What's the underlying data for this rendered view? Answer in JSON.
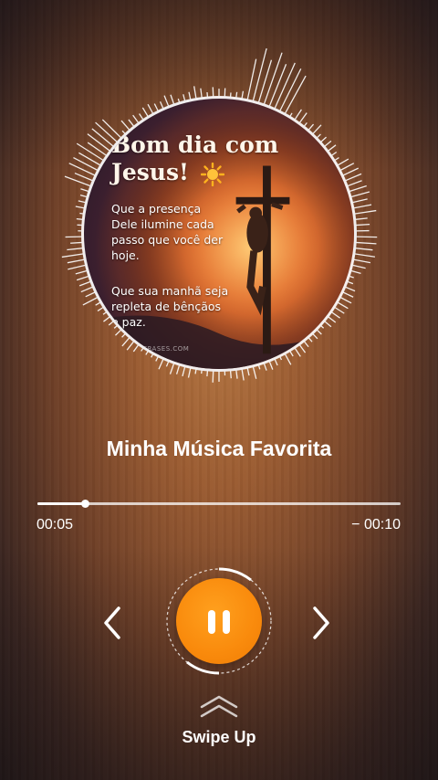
{
  "album_art": {
    "title_line1": "Bom dia com",
    "title_line2": "Jesus!",
    "text1": "Que a presença Dele ilumine cada passo que você der hoje.",
    "text2": "Que sua manhã seja repleta de bênçãos e paz.",
    "watermark": "SFRASES.COM"
  },
  "player": {
    "song_title": "Minha Música Favorita",
    "elapsed": "00:05",
    "remaining": "− 00:10",
    "progress_fraction": 0.13,
    "state": "playing"
  },
  "icons": {
    "prev": "chevron-left-icon",
    "next": "chevron-right-icon",
    "play_pause": "pause-icon",
    "swipe": "chevron-double-up-icon",
    "sun": "sun-icon"
  },
  "colors": {
    "accent": "#F98A0C"
  },
  "swipe": {
    "label": "Swipe Up"
  }
}
